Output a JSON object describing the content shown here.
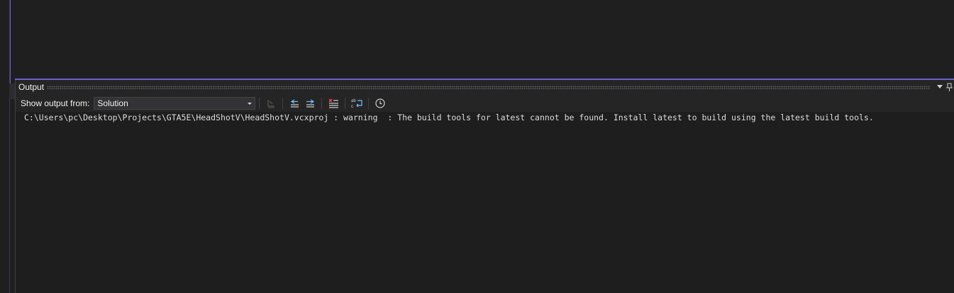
{
  "panel": {
    "title": "Output",
    "title_buttons": {
      "dropdown_icon": "chevron-down-icon",
      "pin_icon": "pin-icon"
    }
  },
  "toolbar": {
    "show_output_label": "Show output from:",
    "source_select": {
      "value": "Solution"
    },
    "buttons": [
      {
        "name": "go-to-line-button",
        "icon": "go-to-line-icon",
        "enabled": false
      },
      {
        "name": "previous-message-button",
        "icon": "previous-message-icon",
        "enabled": true
      },
      {
        "name": "next-message-button",
        "icon": "next-message-icon",
        "enabled": true
      },
      {
        "name": "clear-all-button",
        "icon": "clear-all-icon",
        "enabled": true
      },
      {
        "name": "word-wrap-button",
        "icon": "word-wrap-icon",
        "enabled": true
      },
      {
        "name": "timestamp-button",
        "icon": "clock-icon",
        "enabled": true
      }
    ]
  },
  "output": {
    "lines": [
      "C:\\Users\\pc\\Desktop\\Projects\\GTA5E\\HeadShotV\\HeadShotV.vcxproj : warning  : The build tools for latest cannot be found. Install latest to build using the latest build tools."
    ]
  },
  "colors": {
    "accent": "#6b5fd0",
    "panel_bg": "#252526",
    "content_bg": "#1e1e1e",
    "text": "#dcdcdc",
    "icon_blue": "#75beff",
    "icon_red": "#f14c4c"
  }
}
